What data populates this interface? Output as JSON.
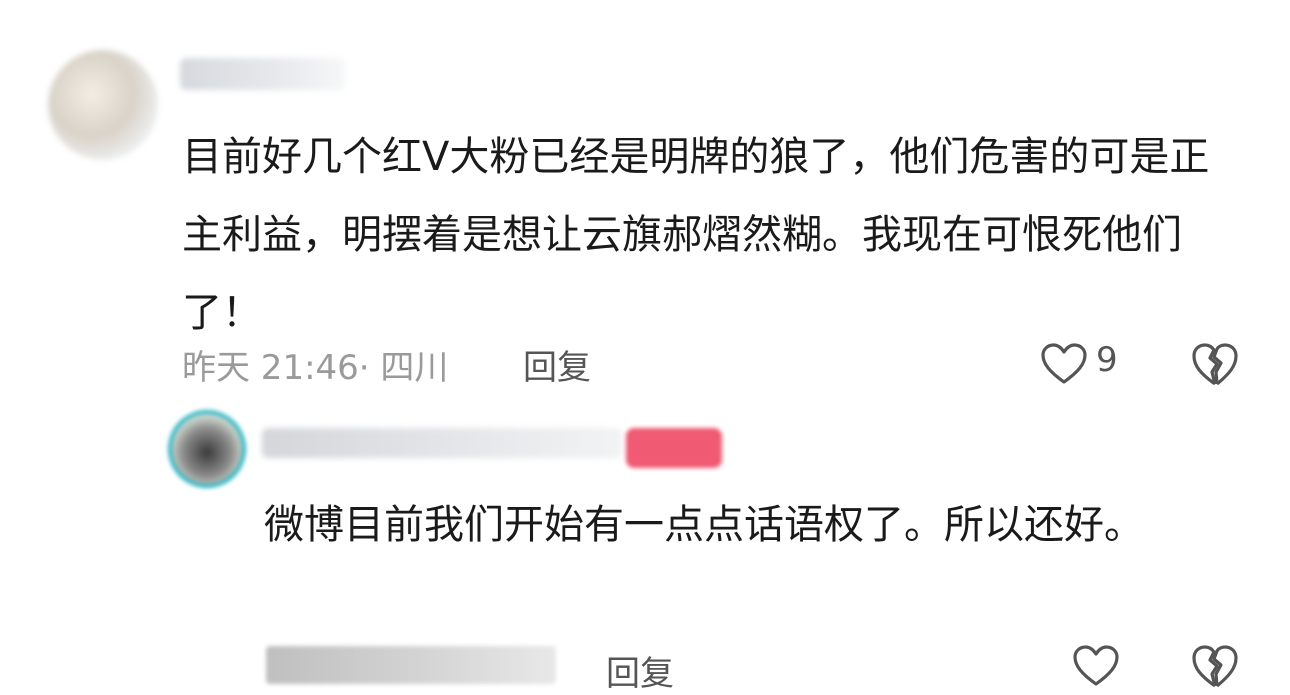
{
  "comments": [
    {
      "text": "目前好几个红V大粉已经是明牌的狼了，他们危害的可是正主利益，明摆着是想让云旗郝熠然糊。我现在可恨死他们了！",
      "meta": "昨天 21:46· 四川",
      "reply_label": "回复",
      "like_count": "9",
      "like_icon": "heart-outline-icon",
      "dislike_icon": "broken-heart-icon"
    },
    {
      "text": "微博目前我们开始有一点点话语权了。所以还好。",
      "reply_label": "回复",
      "like_icon": "heart-outline-icon",
      "dislike_icon": "broken-heart-icon"
    }
  ]
}
